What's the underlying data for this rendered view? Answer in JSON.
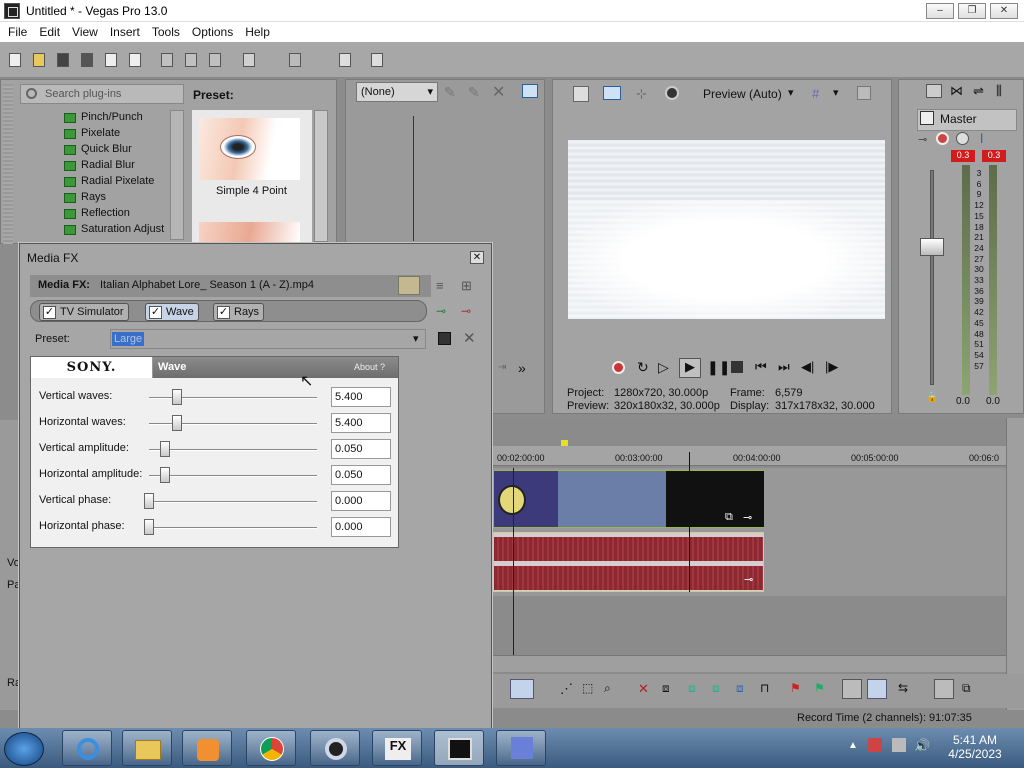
{
  "window": {
    "title": "Untitled * - Vegas Pro 13.0",
    "controls": {
      "minimize": "–",
      "restore": "❐",
      "close": "✕"
    }
  },
  "menu": [
    "File",
    "Edit",
    "View",
    "Insert",
    "Tools",
    "Options",
    "Help"
  ],
  "plugins": {
    "search_placeholder": "Search plug-ins",
    "items": [
      "Pinch/Punch",
      "Pixelate",
      "Quick Blur",
      "Radial Blur",
      "Radial Pixelate",
      "Rays",
      "Reflection",
      "Saturation Adjust"
    ],
    "preset_header": "Preset:",
    "preset_item": "Simple 4 Point"
  },
  "trimmer": {
    "dropdown_value": "(None)"
  },
  "preview": {
    "mode": "Preview (Auto)",
    "project_label": "Project:",
    "project_value": "1280x720, 30.000p",
    "preview_label": "Preview:",
    "preview_value": "320x180x32, 30.000p",
    "frame_label": "Frame:",
    "frame_value": "6,579",
    "display_label": "Display:",
    "display_value": "317x178x32, 30.000"
  },
  "master": {
    "label": "Master",
    "peak_left": "0.3",
    "peak_right": "0.3",
    "scale": [
      "3",
      "6",
      "9",
      "12",
      "15",
      "18",
      "21",
      "24",
      "27",
      "30",
      "33",
      "36",
      "39",
      "42",
      "45",
      "48",
      "51",
      "54",
      "57"
    ],
    "level_left": "0.0",
    "level_right": "0.0"
  },
  "mediafx": {
    "title": "Media FX",
    "close": "✕",
    "header_label": "Media FX:",
    "header_file": "Italian Alphabet Lore_ Season 1 (A - Z).mp4",
    "chain": [
      "TV Simulator",
      "Wave",
      "Rays"
    ],
    "preset_label": "Preset:",
    "preset_value": "Large",
    "brand": "SONY.",
    "plugin_name": "Wave",
    "about": "About  ?",
    "params": [
      {
        "label": "Vertical waves:",
        "value": "5.400"
      },
      {
        "label": "Horizontal waves:",
        "value": "5.400"
      },
      {
        "label": "Vertical amplitude:",
        "value": "0.050"
      },
      {
        "label": "Horizontal amplitude:",
        "value": "0.050"
      },
      {
        "label": "Vertical phase:",
        "value": "0.000"
      },
      {
        "label": "Horizontal phase:",
        "value": "0.000"
      }
    ]
  },
  "timeline": {
    "ruler": [
      "00:02:00:00",
      "00:03:00:00",
      "00:04:00:00",
      "00:05:00:00",
      "00:06:0"
    ],
    "left_labels": [
      "Vo",
      "Pa",
      "Ra"
    ]
  },
  "status": {
    "record_time": "Record Time (2 channels): 91:07:35"
  },
  "taskbar": {
    "time": "5:41 AM",
    "date": "4/25/2023"
  }
}
